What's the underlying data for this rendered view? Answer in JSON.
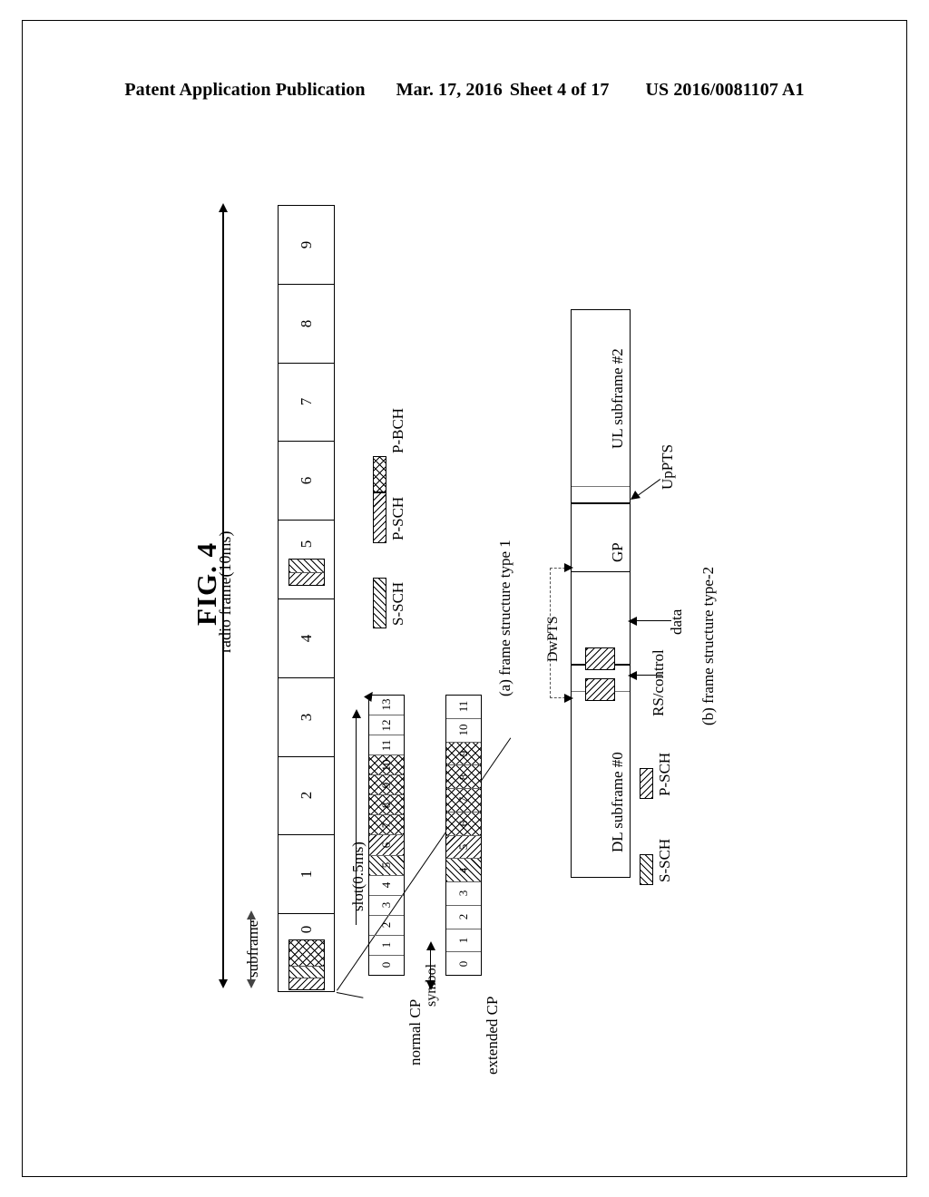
{
  "header": {
    "publication": "Patent Application Publication",
    "date": "Mar. 17, 2016",
    "sheet": "Sheet 4 of 17",
    "patent_number": "US 2016/0081107 A1"
  },
  "figure": {
    "title": "FIG. 4"
  },
  "frame_type1": {
    "caption": "(a) frame structure type 1",
    "radio_frame_label": "radio frame(10ms)",
    "subframe_label": "subframe",
    "slot_label": "slot(0.5ms)",
    "symbol_label": "symbol",
    "subframes": [
      "0",
      "1",
      "2",
      "3",
      "4",
      "5",
      "6",
      "7",
      "8",
      "9"
    ],
    "normal_cp_label": "normal CP",
    "extended_cp_label": "extended CP",
    "normal_cp_symbols": [
      "0",
      "1",
      "2",
      "3",
      "4",
      "5",
      "6",
      "7",
      "8",
      "9",
      "10",
      "11",
      "12",
      "13"
    ],
    "extended_cp_symbols": [
      "0",
      "1",
      "2",
      "3",
      "4",
      "5",
      "6",
      "7",
      "8",
      "9",
      "10",
      "11"
    ],
    "legend": [
      {
        "name": "S-SCH",
        "pattern": "back-diagonal-hatch"
      },
      {
        "name": "P-SCH",
        "pattern": "forward-diagonal-hatch"
      },
      {
        "name": "P-BCH",
        "pattern": "crosshatch"
      }
    ]
  },
  "frame_type2": {
    "caption": "(b) frame structure type-2",
    "segments": [
      {
        "name": "DL subframe #0"
      },
      {
        "name": "GP"
      },
      {
        "name": "UL subframe #2"
      }
    ],
    "dwpts_label": "DwPTS",
    "uppts_label": "UpPTS",
    "data_label": "data",
    "rs_control_label": "RS/control",
    "legend": [
      {
        "name": "S-SCH",
        "pattern": "back-diagonal-hatch"
      },
      {
        "name": "P-SCH",
        "pattern": "forward-diagonal-hatch"
      }
    ]
  }
}
